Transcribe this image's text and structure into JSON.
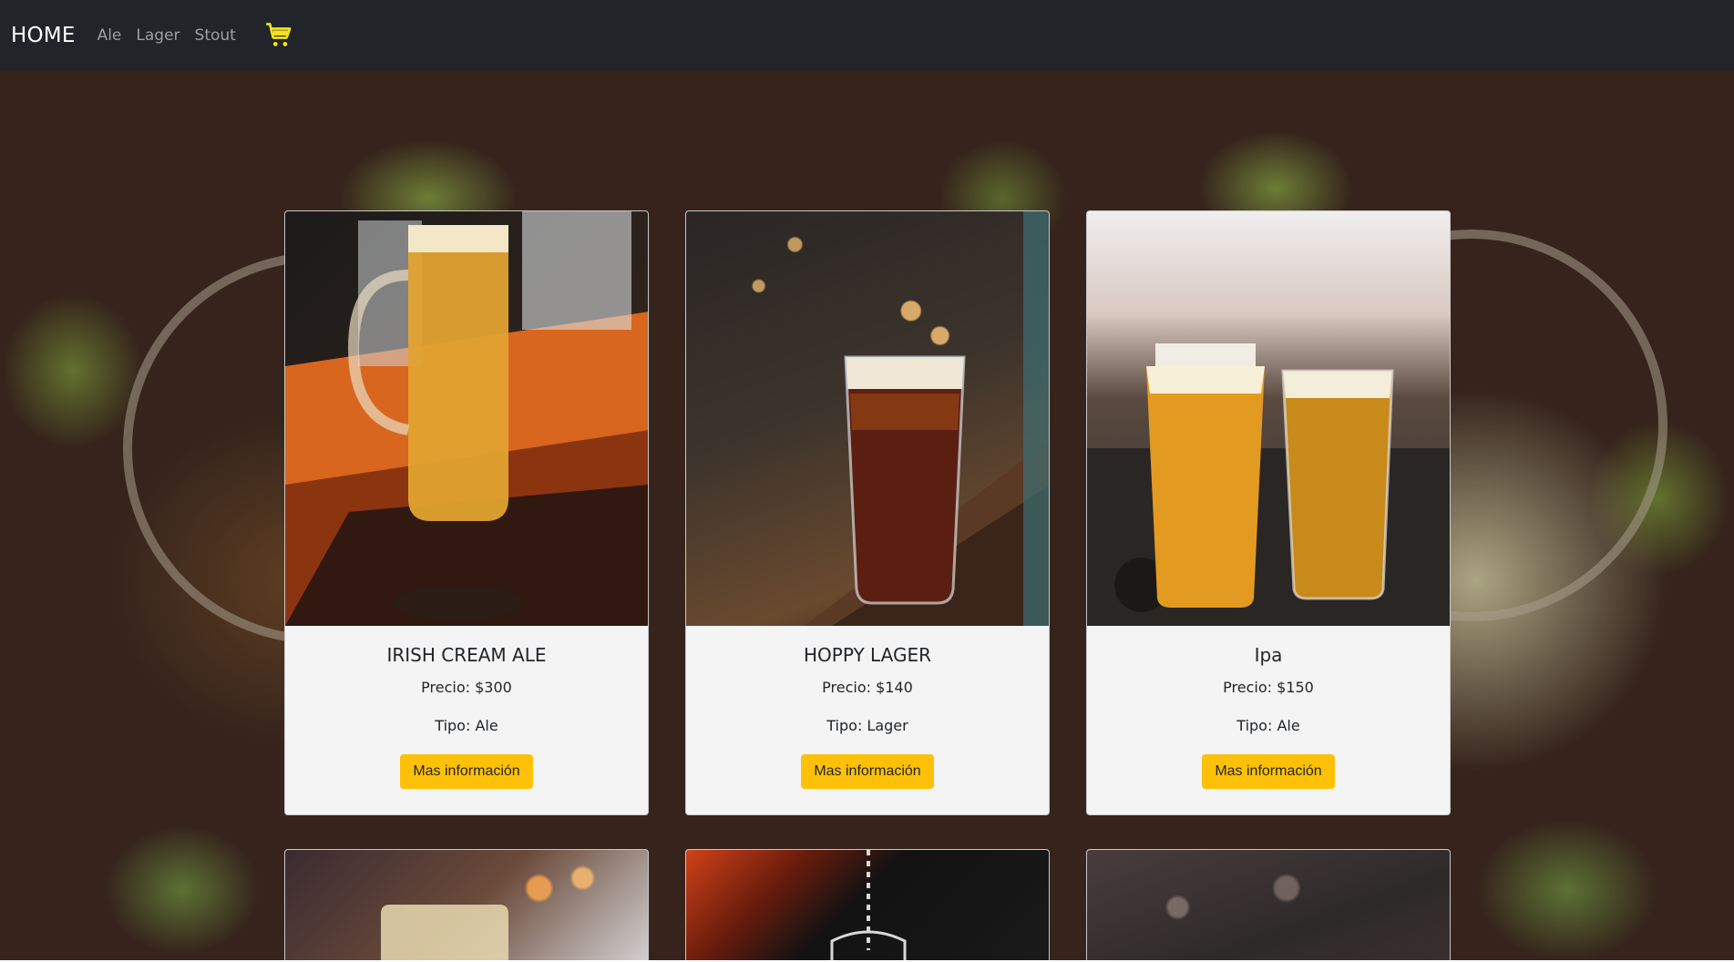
{
  "navbar": {
    "brand": "HOME",
    "links": [
      "Ale",
      "Lager",
      "Stout"
    ],
    "cart_icon": "shopping-cart-icon",
    "cart_color": "#f7e21b",
    "background": "#212529"
  },
  "products": [
    {
      "title": "IRISH CREAM ALE",
      "price": "Precio: $300",
      "type": "Tipo: Ale",
      "button": "Mas información"
    },
    {
      "title": "HOPPY LAGER",
      "price": "Precio: $140",
      "type": "Tipo: Lager",
      "button": "Mas información"
    },
    {
      "title": "Ipa",
      "price": "Precio: $150",
      "type": "Tipo: Ale",
      "button": "Mas información"
    }
  ],
  "colors": {
    "button": "#ffc107",
    "card_background": "#f4f4f4"
  }
}
